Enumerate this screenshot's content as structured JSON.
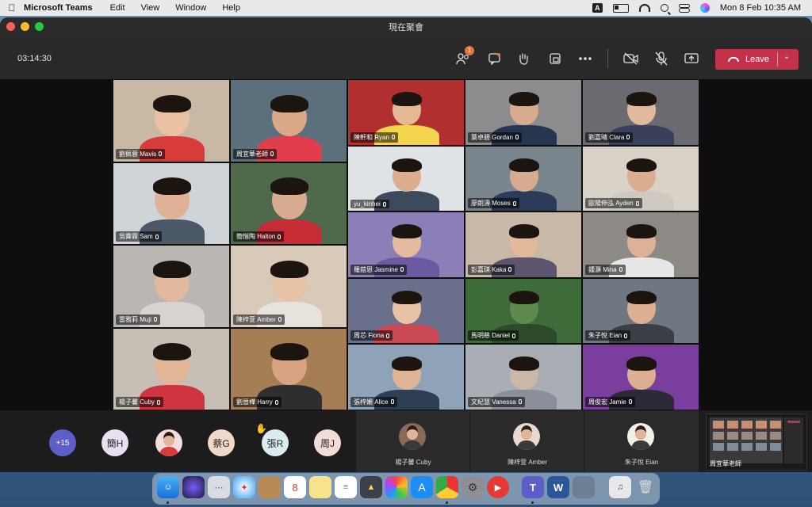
{
  "menubar": {
    "app_name": "Microsoft Teams",
    "menus": [
      "Edit",
      "View",
      "Window",
      "Help"
    ],
    "input_source": "A",
    "datetime": "Mon 8 Feb  10:35 AM"
  },
  "window": {
    "title": "現在聚會"
  },
  "toolbar": {
    "timer": "03:14:30",
    "participants_badge": "1",
    "leave_label": "Leave"
  },
  "gallery": {
    "left": [
      {
        "name": "劉佩蓉 Mavis",
        "colors": {
          "bg": "#c9b8a3",
          "skin": "#e9c2a3",
          "shirt": "#d93b3b"
        }
      },
      {
        "name": "周宜華老師",
        "colors": {
          "bg": "#5b6f7d",
          "skin": "#d9a98a",
          "shirt": "#e23d4b"
        }
      },
      {
        "name": "吳霽霖 Sam",
        "colors": {
          "bg": "#cfd4d9",
          "skin": "#dfb196",
          "shirt": "#4a5868"
        }
      },
      {
        "name": "簡愷陶 Halton",
        "colors": {
          "bg": "#4f6a4b",
          "skin": "#d7ac90",
          "shirt": "#c72c35"
        }
      },
      {
        "name": "雷雅莉 Muji",
        "colors": {
          "bg": "#b9b6b3",
          "skin": "#e1b99d",
          "shirt": "#d8d3ce"
        }
      },
      {
        "name": "陳梓萱 Amber",
        "colors": {
          "bg": "#d8c9b8",
          "skin": "#e7c3a6",
          "shirt": "#e8e2dc"
        }
      },
      {
        "name": "楊子馨 Cuby",
        "colors": {
          "bg": "#c7bfb6",
          "skin": "#e3b597",
          "shirt": "#cf3540"
        }
      },
      {
        "name": "劉晉樺 Harry",
        "colors": {
          "bg": "#a67e55",
          "skin": "#d7a383",
          "shirt": "#2e2e2e"
        }
      }
    ],
    "right": [
      {
        "name": "陳軒和 Ryan",
        "colors": {
          "bg": "#b22f2f",
          "skin": "#e5b996",
          "shirt": "#f2d44d"
        }
      },
      {
        "name": "葉卓碧 Gordan",
        "colors": {
          "bg": "#8c8c8f",
          "skin": "#d7ab8d",
          "shirt": "#27364e"
        }
      },
      {
        "name": "劉嘉晴 Clara",
        "colors": {
          "bg": "#6b6a70",
          "skin": "#e2b99c",
          "shirt": "#3a3f5a"
        }
      },
      {
        "name": "yu_kinhei",
        "colors": {
          "bg": "#dfe3e5",
          "skin": "#dcae90",
          "shirt": "#3d4a5e"
        }
      },
      {
        "name": "廖朗濤 Moses",
        "colors": {
          "bg": "#7b858e",
          "skin": "#d7ab8f",
          "shirt": "#2c3b59"
        }
      },
      {
        "name": "歐陽伸泓 Ayden",
        "colors": {
          "bg": "#d9d2c8",
          "skin": "#dcae91",
          "shirt": "#cfc9c2"
        }
      },
      {
        "name": "羅鎧恩 Jasmine",
        "colors": {
          "bg": "#8c7fb8",
          "skin": "#e4bba0",
          "shirt": "#6b5aa2"
        }
      },
      {
        "name": "彭嘉琪 Kaka",
        "colors": {
          "bg": "#c8b8a8",
          "skin": "#e3b99b",
          "shirt": "#5d5470"
        }
      },
      {
        "name": "鍾灝 Mina",
        "colors": {
          "bg": "#8d8a86",
          "skin": "#dcb195",
          "shirt": "#e6e6e6"
        }
      },
      {
        "name": "周芯 Fiona",
        "colors": {
          "bg": "#6a6f8c",
          "skin": "#e8c2a5",
          "shirt": "#c94a55"
        }
      },
      {
        "name": "馬明慈 Daniel",
        "colors": {
          "bg": "#3d6b3a",
          "skin": "#5f8a4d",
          "shirt": "#2d4a2a"
        }
      },
      {
        "name": "朱子悅 Eian",
        "colors": {
          "bg": "#6f7780",
          "skin": "#ddb094",
          "shirt": "#3a3f46"
        }
      },
      {
        "name": "張梓姍 Alice",
        "colors": {
          "bg": "#8fa3b8",
          "skin": "#dfb497",
          "shirt": "#2e3e54"
        }
      },
      {
        "name": "文紀慧 Vanessa",
        "colors": {
          "bg": "#a9adb4",
          "skin": "#c9b8aa",
          "shirt": "#8a8f99"
        }
      },
      {
        "name": "周俊宏 Jamie",
        "colors": {
          "bg": "#7a3f9e",
          "skin": "#dcae92",
          "shirt": "#2b2b38"
        }
      }
    ]
  },
  "strip": {
    "more_count": "+15",
    "avatars": [
      {
        "initials": "簡H",
        "color": "#e8e0f0"
      },
      {
        "initials": "",
        "color": "#f3dede"
      },
      {
        "initials": "蔡G",
        "color": "#f0d9c8"
      },
      {
        "initials": "張R",
        "color": "#d9ecef"
      },
      {
        "initials": "周J",
        "color": "#f2dcd6"
      }
    ],
    "mini_tiles": [
      {
        "name": "楊子馨 Cuby",
        "color": "#8a6b5a"
      },
      {
        "name": "陳梓萱 Amber",
        "color": "#e7d9cf"
      },
      {
        "name": "朱子悅 Eian",
        "color": "#f2efe9"
      }
    ],
    "self_view_label": "周宜華老師"
  }
}
